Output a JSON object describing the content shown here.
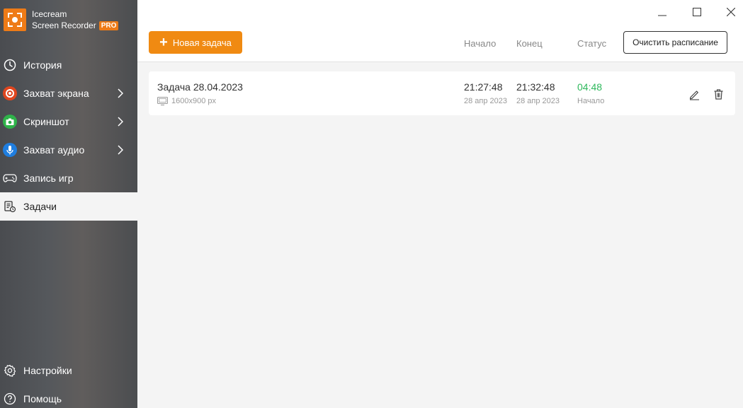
{
  "app": {
    "name_line1": "Icecream",
    "name_line2": "Screen Recorder",
    "badge": "PRO",
    "brand_color": "#ee7b17"
  },
  "sidebar": {
    "items": [
      {
        "label": "История",
        "icon": "clock-icon"
      },
      {
        "label": "Захват экрана",
        "icon": "record-icon",
        "icon_color": "#e0461f",
        "has_submenu": true
      },
      {
        "label": "Скриншот",
        "icon": "camera-icon",
        "icon_color": "#2fb34a",
        "has_submenu": true
      },
      {
        "label": "Захват аудио",
        "icon": "microphone-icon",
        "icon_color": "#1f7ee0",
        "has_submenu": true
      },
      {
        "label": "Запись игр",
        "icon": "gamepad-icon"
      },
      {
        "label": "Задачи",
        "icon": "tasks-icon",
        "active": true
      }
    ],
    "bottom_items": [
      {
        "label": "Настройки",
        "icon": "gear-icon"
      },
      {
        "label": "Помощь",
        "icon": "help-icon"
      }
    ]
  },
  "toolbar": {
    "new_task_label": "Новая задача",
    "clear_schedule_label": "Очистить расписание",
    "accent_color": "#f08a12"
  },
  "columns": {
    "start": "Начало",
    "end": "Конец",
    "status": "Статус"
  },
  "tasks": [
    {
      "name": "Задача 28.04.2023",
      "resolution": "1600x900 px",
      "start_time": "21:27:48",
      "start_date": "28 апр 2023",
      "end_time": "21:32:48",
      "end_date": "28 апр 2023",
      "status_value": "04:48",
      "status_label": "Начало",
      "status_color": "#2eb85c"
    }
  ]
}
